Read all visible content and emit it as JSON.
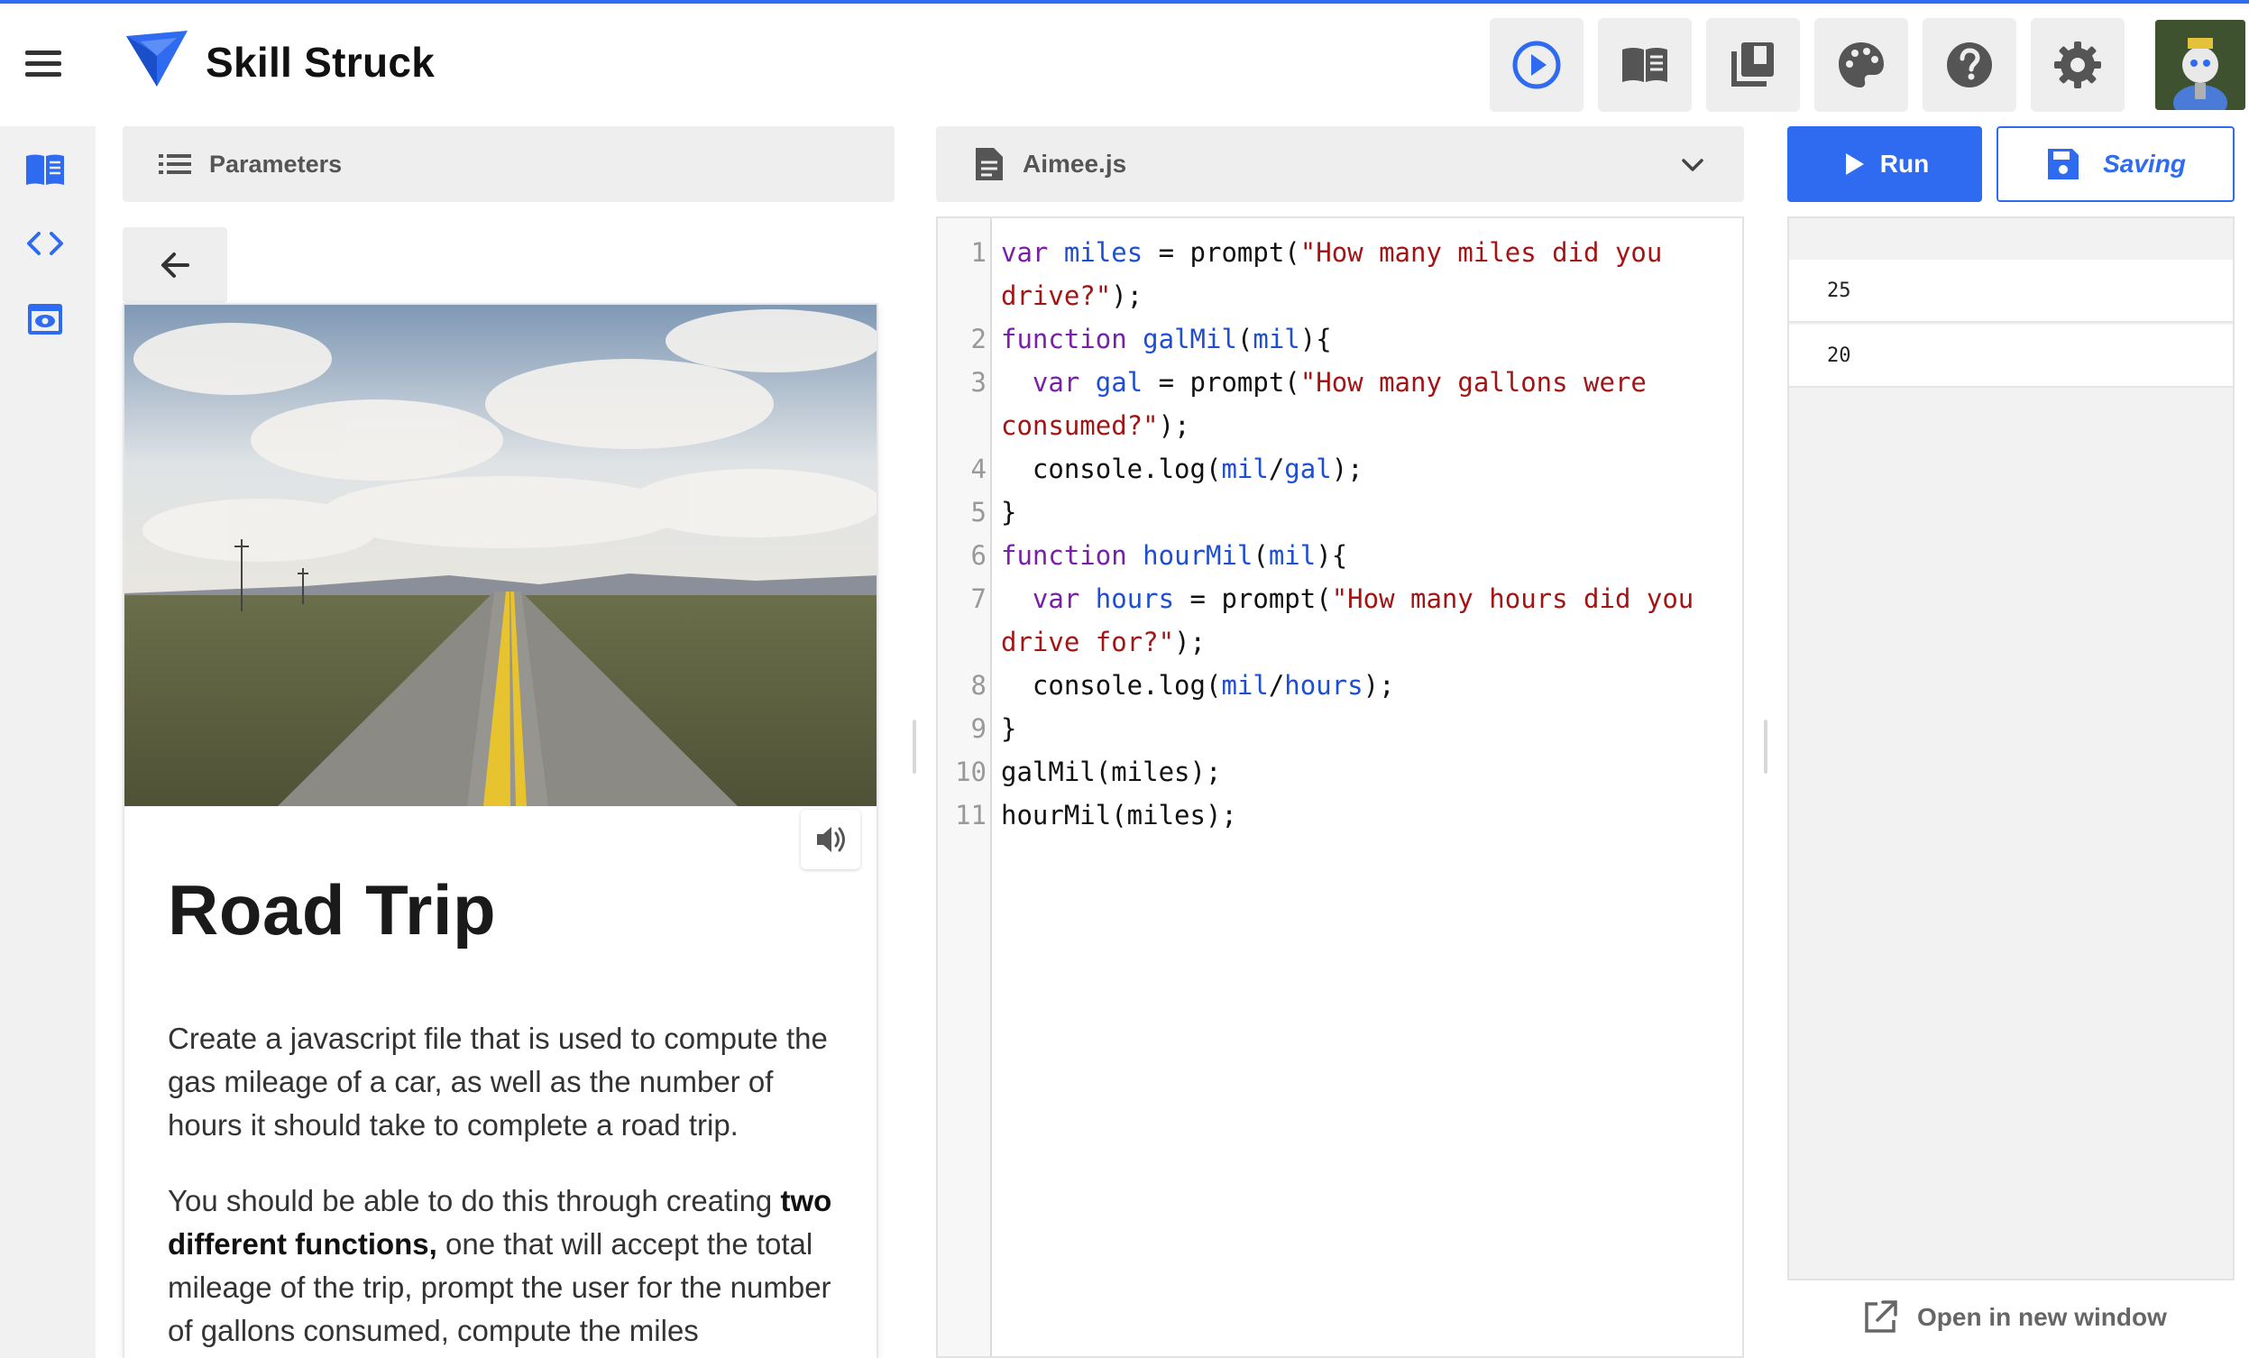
{
  "header": {
    "brand": "Skill Struck",
    "toolbar": {
      "run_preview": "play-circle-icon",
      "instructions": "book-icon",
      "library": "library-icon",
      "theme": "palette-icon",
      "help": "help-icon",
      "settings": "gear-icon"
    },
    "accent_color": "#2f6bf0"
  },
  "rail": {
    "items": [
      "book-icon",
      "code-icon",
      "preview-icon"
    ]
  },
  "parameters": {
    "label": "Parameters"
  },
  "lesson": {
    "title": "Road Trip",
    "paragraph1": "Create a javascript file that is used to compute the gas mileage of a car, as well as the number of hours it should take to complete a road trip.",
    "paragraph2_pre": "You should be able to do this through creating ",
    "paragraph2_bold": "two different functions,",
    "paragraph2_post": " one that will accept the total mileage of the trip, prompt the user for the number of gallons consumed, compute the miles"
  },
  "editor": {
    "filename": "Aimee.js",
    "line_numbers": [
      "1",
      "2",
      "3",
      "4",
      "5",
      "6",
      "7",
      "8",
      "9",
      "10",
      "11"
    ],
    "tokens": {
      "var": "var",
      "function": "function",
      "prompt": " = prompt(",
      "l1_name": "miles",
      "l1_str": "\"How many miles did you drive?\"",
      "l1_end": ");",
      "l2_name": "galMil",
      "l2_open": "(",
      "l2_param": "mil",
      "l2_close": "){",
      "l3_name": "gal",
      "l3_str": "\"How many gallons were consumed?\"",
      "l3_end": ");",
      "log": "console.log(",
      "l4_a": "mil",
      "slash": "/",
      "l4_b": "gal",
      "log_end": ");",
      "brace": "}",
      "l6_name": "hourMil",
      "l6_open": "(",
      "l6_param": "mil",
      "l6_close": "){",
      "l7_name": "hours",
      "l7_str": "\"How many hours did you drive for?\"",
      "l7_end": ");",
      "l8_a": "mil",
      "l8_b": "hours",
      "l10": "galMil(miles);",
      "l11": "hourMil(miles);"
    }
  },
  "output": {
    "run_label": "Run",
    "save_label": "Saving",
    "lines": [
      "25",
      "20"
    ],
    "open_new_window": "Open in new window"
  }
}
